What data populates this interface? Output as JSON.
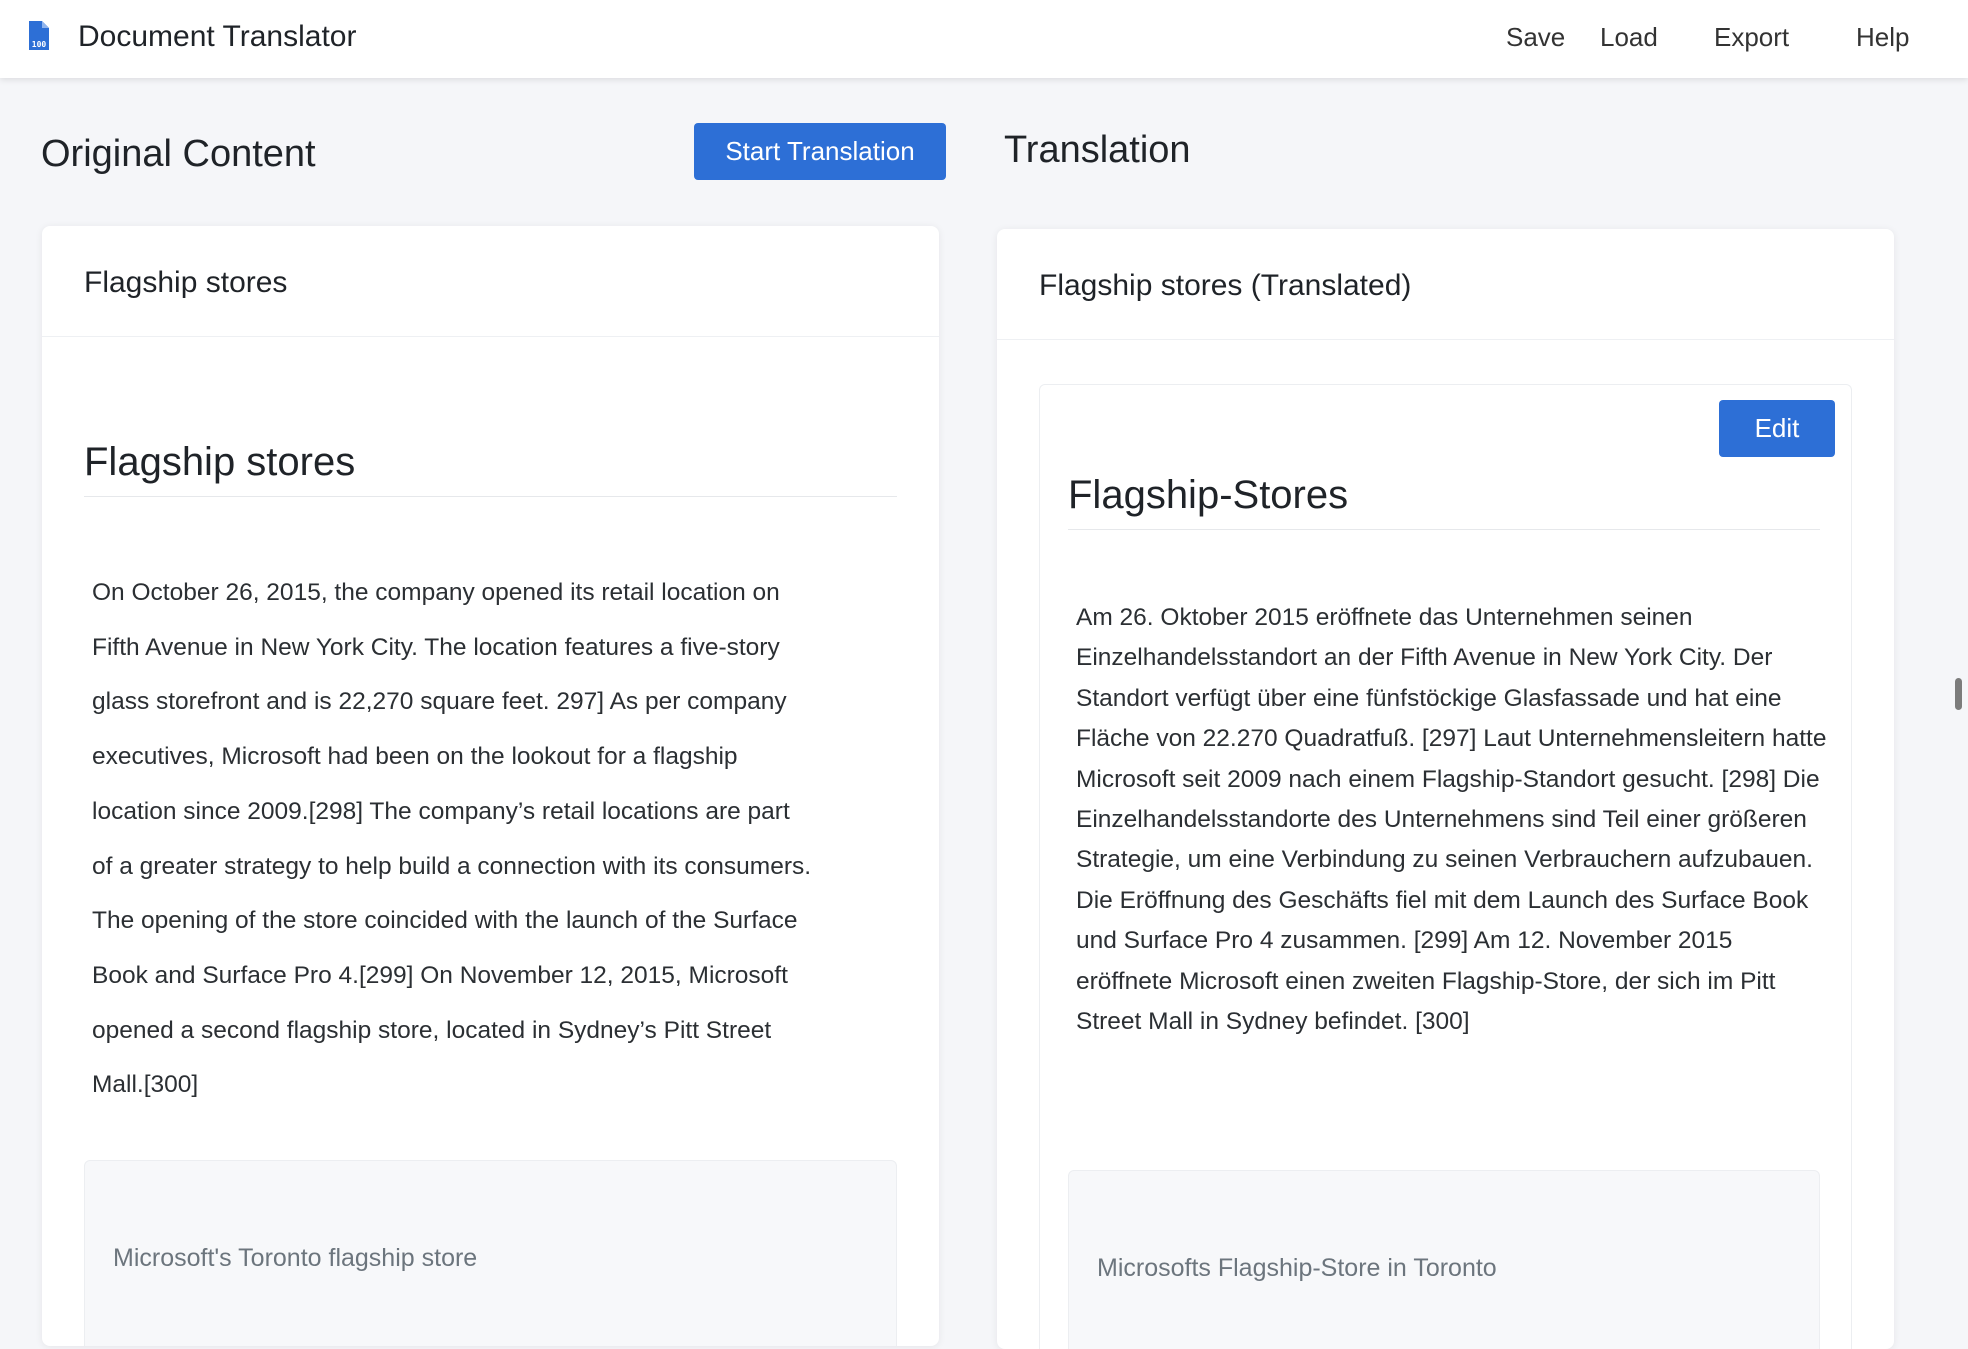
{
  "app": {
    "title": "Document Translator",
    "logo_icon": "document-file-icon"
  },
  "nav": {
    "save": "Save",
    "load": "Load",
    "export": "Export",
    "help": "Help"
  },
  "original": {
    "section_title": "Original Content",
    "start_button": "Start Translation",
    "card_title": "Flagship stores",
    "heading": "Flagship stores",
    "paragraph": "On October 26, 2015, the company opened its retail location on Fifth Avenue in New York City. The location features a five-story glass storefront and is 22,270 square feet. 297] As per company executives, Microsoft had been on the lookout for a flagship location since 2009.[298] The company’s retail locations are part of a greater strategy to help build a connection with its consumers. The opening of the store coincided with the launch of the Surface Book and Surface Pro 4.[299] On November 12, 2015, Microsoft opened a second flagship store, located in Sydney’s Pitt Street Mall.[300]",
    "figure_caption": "Microsoft's Toronto flagship store"
  },
  "translation": {
    "section_title": "Translation",
    "card_title": "Flagship stores (Translated)",
    "edit_button": "Edit",
    "heading": "Flagship-Stores",
    "paragraph": "Am 26. Oktober 2015 eröffnete das Unternehmen seinen Einzelhandelsstandort an der Fifth Avenue in New York City. Der Standort verfügt über eine fünfstöckige Glasfassade und hat eine Fläche von 22.270 Quadratfuß. [297] Laut Unternehmensleitern hatte Microsoft seit 2009 nach einem Flagship-Standort gesucht. [298] Die Einzelhandelsstandorte des Unternehmens sind Teil einer größeren Strategie, um eine Verbindung zu seinen Verbrauchern aufzubauen. Die Eröffnung des Geschäfts fiel mit dem Launch des Surface Book und Surface Pro 4 zusammen. [299] Am 12. November 2015 eröffnete Microsoft einen zweiten Flagship-Store, der sich im Pitt Street Mall in Sydney befindet. [300]",
    "figure_caption": "Microsofts Flagship-Store in Toronto"
  },
  "colors": {
    "accent": "#2d6fd6",
    "background": "#f5f6f9",
    "card": "#ffffff"
  }
}
